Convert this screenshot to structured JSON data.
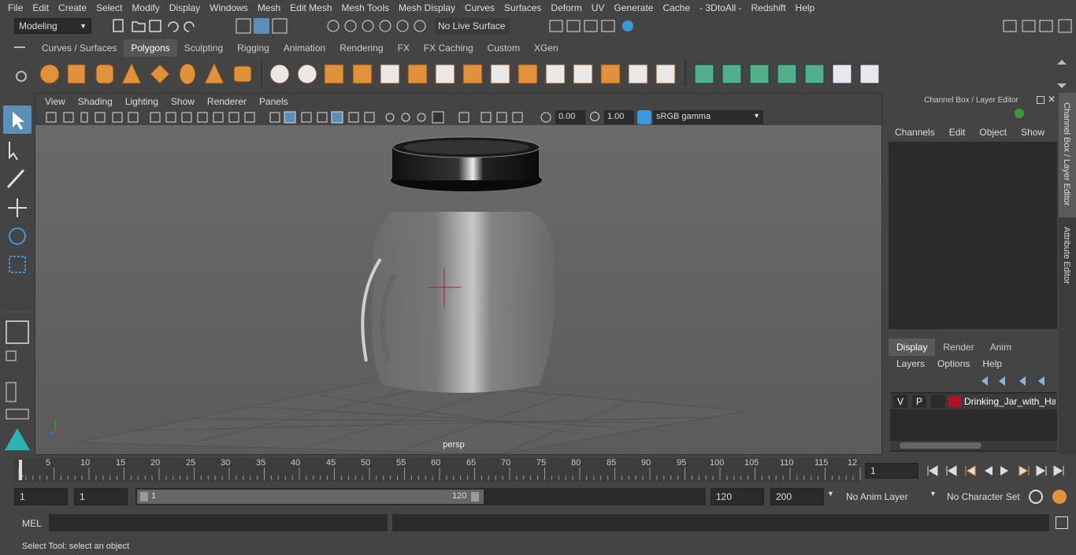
{
  "menu": [
    "File",
    "Edit",
    "Create",
    "Select",
    "Modify",
    "Display",
    "Windows",
    "Mesh",
    "Edit Mesh",
    "Mesh Tools",
    "Mesh Display",
    "Curves",
    "Surfaces",
    "Deform",
    "UV",
    "Generate",
    "Cache",
    "- 3DtoAll -",
    "Redshift",
    "Help"
  ],
  "status": {
    "mode": "Modeling",
    "live_surface": "No Live Surface"
  },
  "shelf_tabs": [
    "Curves / Surfaces",
    "Polygons",
    "Sculpting",
    "Rigging",
    "Animation",
    "Rendering",
    "FX",
    "FX Caching",
    "Custom",
    "XGen"
  ],
  "active_shelf_tab": "Polygons",
  "viewport": {
    "menus": [
      "View",
      "Shading",
      "Lighting",
      "Show",
      "Renderer",
      "Panels"
    ],
    "exposure": "0.00",
    "gamma": "1.00",
    "color_space": "sRGB gamma",
    "camera_label": "persp"
  },
  "channel_box": {
    "title": "Channel Box / Layer Editor",
    "menus": [
      "Channels",
      "Edit",
      "Object",
      "Show"
    ],
    "layer_tabs": [
      "Display",
      "Render",
      "Anim"
    ],
    "active_layer_tab": "Display",
    "layer_menus": [
      "Layers",
      "Options",
      "Help"
    ],
    "layer": {
      "v": "V",
      "p": "P",
      "name": "Drinking_Jar_with_Har",
      "color": "#b0102a"
    }
  },
  "side_tabs": [
    "Channel Box / Layer Editor",
    "Attribute Editor"
  ],
  "timeline": {
    "ticks": [
      "5",
      "10",
      "15",
      "20",
      "25",
      "30",
      "35",
      "40",
      "45",
      "50",
      "55",
      "60",
      "65",
      "70",
      "75",
      "80",
      "85",
      "90",
      "95",
      "100",
      "105",
      "110",
      "115",
      "12"
    ],
    "start_marker": "1",
    "current_frame": "1"
  },
  "range": {
    "start": "1",
    "playback_start": "1",
    "slider_start": "1",
    "slider_end": "120",
    "playback_end": "120",
    "end": "200",
    "anim_layer": "No Anim Layer",
    "character_set": "No Character Set"
  },
  "command": {
    "lang": "MEL"
  },
  "help_line": "Select Tool: select an object"
}
